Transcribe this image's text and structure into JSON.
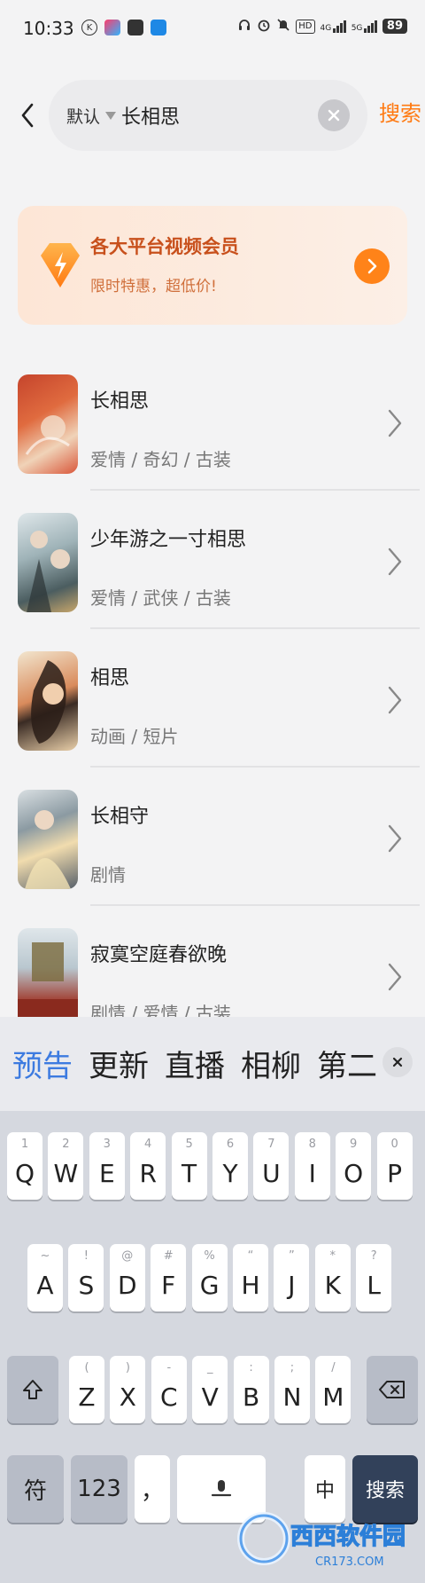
{
  "status_bar": {
    "time": "10:33",
    "battery": "89",
    "net_hd": "HD",
    "net_4g": "4G",
    "net_5g": "5G"
  },
  "search": {
    "scope": "默认",
    "query": "长相思",
    "button": "搜索"
  },
  "promo": {
    "title": "各大平台视频会员",
    "subtitle": "限时特惠，超低价!"
  },
  "results": [
    {
      "title": "长相思",
      "tags": "爱情 / 奇幻 / 古装"
    },
    {
      "title": "少年游之一寸相思",
      "tags": "爱情 / 武侠 / 古装"
    },
    {
      "title": "相思",
      "tags": "动画 / 短片"
    },
    {
      "title": "长相守",
      "tags": "剧情"
    },
    {
      "title": "寂寞空庭春欲晚",
      "tags": "剧情 / 爱情 / 古装"
    }
  ],
  "keyboard": {
    "candidates": [
      "预告",
      "更新",
      "直播",
      "相柳",
      "第二"
    ],
    "highlight_candidate": "预告",
    "row1": [
      {
        "k": "Q",
        "s": "1"
      },
      {
        "k": "W",
        "s": "2"
      },
      {
        "k": "E",
        "s": "3"
      },
      {
        "k": "R",
        "s": "4"
      },
      {
        "k": "T",
        "s": "5"
      },
      {
        "k": "Y",
        "s": "6"
      },
      {
        "k": "U",
        "s": "7"
      },
      {
        "k": "I",
        "s": "8"
      },
      {
        "k": "O",
        "s": "9"
      },
      {
        "k": "P",
        "s": "0"
      }
    ],
    "row2": [
      {
        "k": "A",
        "s": "~"
      },
      {
        "k": "S",
        "s": "!"
      },
      {
        "k": "D",
        "s": "@"
      },
      {
        "k": "F",
        "s": "#"
      },
      {
        "k": "G",
        "s": "%"
      },
      {
        "k": "H",
        "s": "“"
      },
      {
        "k": "J",
        "s": "”"
      },
      {
        "k": "K",
        "s": "*"
      },
      {
        "k": "L",
        "s": "?"
      }
    ],
    "row3": [
      {
        "k": "Z",
        "s": "("
      },
      {
        "k": "X",
        "s": ")"
      },
      {
        "k": "C",
        "s": "-"
      },
      {
        "k": "V",
        "s": "_"
      },
      {
        "k": "B",
        "s": ":"
      },
      {
        "k": "N",
        "s": ";"
      },
      {
        "k": "M",
        "s": "/"
      }
    ],
    "symbol_key": "符",
    "num_key": "123",
    "comma_key": "，",
    "lang_key": "中",
    "enter_key": "搜索"
  },
  "watermark": {
    "brand": "西西软件园",
    "domain": "CR173.COM"
  },
  "colors": {
    "accent": "#ff7a12",
    "candidate_highlight": "#3d7be0",
    "promo_title": "#c8501c",
    "enter_key": "#32415a"
  }
}
